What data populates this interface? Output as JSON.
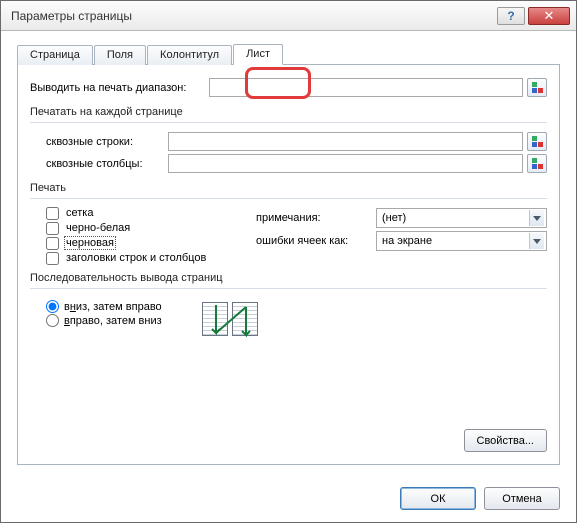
{
  "window": {
    "title": "Параметры страницы"
  },
  "tabs": {
    "page": "Страница",
    "margins": "Поля",
    "headerfooter": "Колонтитул",
    "sheet": "Лист"
  },
  "range": {
    "label": "Выводить на печать диапазон:",
    "value": ""
  },
  "repeat": {
    "title": "Печатать на каждой странице",
    "rows_label": "сквозные строки:",
    "rows_value": "",
    "cols_label": "сквозные столбцы:",
    "cols_value": ""
  },
  "print": {
    "title": "Печать",
    "grid": "сетка",
    "bw": "черно-белая",
    "draft": "черновая",
    "headings": "заголовки строк и столбцов",
    "comments_label": "примечания:",
    "comments_value": "(нет)",
    "errors_label": "ошибки ячеек как:",
    "errors_value": "на экране"
  },
  "order": {
    "title": "Последовательность вывода страниц",
    "down_then_over_pre": "в",
    "down_then_over_u": "н",
    "down_then_over_post": "из, затем вправо",
    "over_then_down_pre": "вправо, затем вниз"
  },
  "buttons": {
    "props": "Свойства...",
    "ok": "ОК",
    "cancel": "Отмена"
  }
}
